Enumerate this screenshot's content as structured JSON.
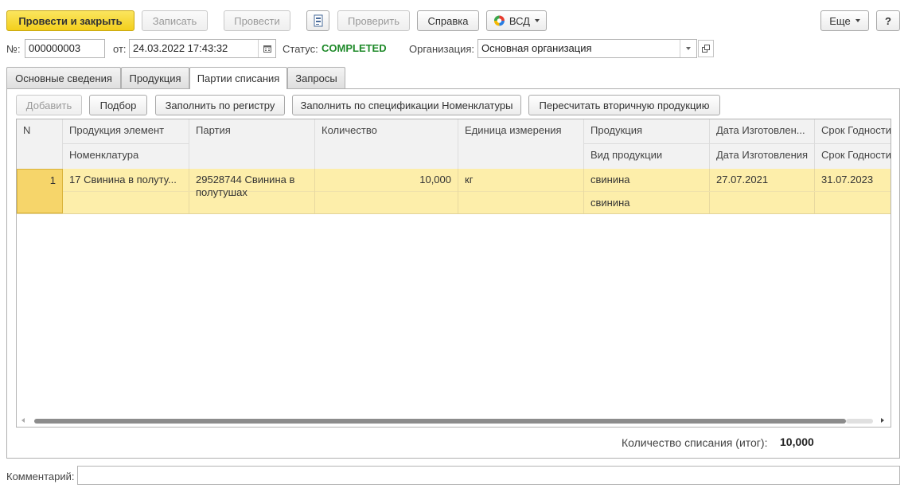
{
  "toolbar": {
    "post_close": "Провести и закрыть",
    "save": "Записать",
    "post": "Провести",
    "check": "Проверить",
    "help": "Справка",
    "vsd": "ВСД",
    "more": "Еще",
    "question": "?"
  },
  "header": {
    "number_label": "№:",
    "number_value": "000000003",
    "date_label": "от:",
    "date_value": "24.03.2022 17:43:32",
    "status_label": "Статус:",
    "status_value": "COMPLETED",
    "org_label": "Организация:",
    "org_value": "Основная организация"
  },
  "tabs": [
    {
      "label": "Основные сведения"
    },
    {
      "label": "Продукция"
    },
    {
      "label": "Партии списания"
    },
    {
      "label": "Запросы"
    }
  ],
  "table_toolbar": {
    "add": "Добавить",
    "select": "Подбор",
    "fill_register": "Заполнить по регистру",
    "fill_spec": "Заполнить по спецификации Номенклатуры",
    "recalc": "Пересчитать вторичную продукцию"
  },
  "table": {
    "columns": {
      "n": "N",
      "product_element": "Продукция элемент",
      "nomenclature": "Номенклатура",
      "batch": "Партия",
      "quantity": "Количество",
      "unit": "Единица измерения",
      "product": "Продукция",
      "product_kind": "Вид продукции",
      "mfg_date_top": "Дата Изготовлен...",
      "mfg_date": "Дата Изготовления",
      "expiry_top": "Срок Годности",
      "expiry": "Срок Годности"
    },
    "rows": [
      {
        "n": "1",
        "product_element": "17 Свинина в полуту...",
        "nomenclature": "",
        "batch": "29528744 Свинина в полутушах",
        "quantity": "10,000",
        "unit": "кг",
        "product": "свинина",
        "product_kind": "свинина",
        "mfg_date": "27.07.2021",
        "expiry": "31.07.2023"
      }
    ]
  },
  "footer": {
    "total_label": "Количество списания (итог):",
    "total_value": "10,000",
    "comment_label": "Комментарий:",
    "comment_value": ""
  },
  "colors": {
    "selected_row": "#fdeeaa",
    "current_cell": "#f6d56a",
    "status_green": "#1f8a2a",
    "primary_button": "#f3cf1c"
  }
}
